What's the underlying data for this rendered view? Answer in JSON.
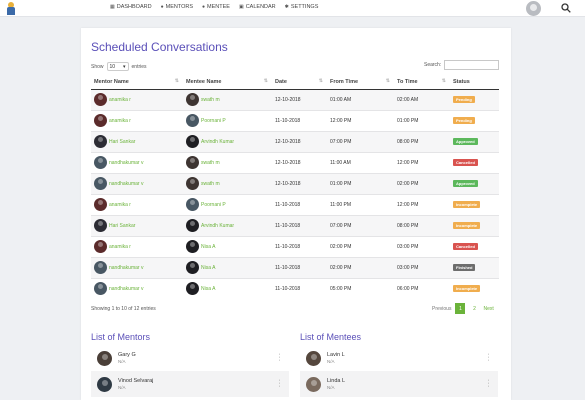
{
  "nav": {
    "items": [
      {
        "label": "DASHBOARD",
        "icon": "grid-icon"
      },
      {
        "label": "MENTORS",
        "icon": "user-icon"
      },
      {
        "label": "MENTEE",
        "icon": "user-icon"
      },
      {
        "label": "CALENDAR",
        "icon": "calendar-icon"
      },
      {
        "label": "SETTINGS",
        "icon": "gear-icon"
      }
    ]
  },
  "conversations": {
    "title": "Scheduled Conversations",
    "show_label": "Show",
    "page_size": "10",
    "entries_label": "entries",
    "search_label": "Search:",
    "search_value": "",
    "columns": [
      "Mentor Name",
      "Mentee Name",
      "Date",
      "From Time",
      "To Time",
      "Status"
    ],
    "rows": [
      {
        "mentor": "anamika r",
        "mentee": "swath m",
        "date": "12-10-2018",
        "from": "01:00 AM",
        "to": "02:00 AM",
        "status": "Pending",
        "color": "#f0ad4e"
      },
      {
        "mentor": "anamika r",
        "mentee": "Poornani P",
        "date": "11-10-2018",
        "from": "12:00 PM",
        "to": "01:00 PM",
        "status": "Pending",
        "color": "#f0ad4e"
      },
      {
        "mentor": "Hari Sankar",
        "mentee": "Arvindh Kumar",
        "date": "12-10-2018",
        "from": "07:00 PM",
        "to": "08:00 PM",
        "status": "Approved",
        "color": "#5cb85c"
      },
      {
        "mentor": "nandhakumar v",
        "mentee": "swath m",
        "date": "12-10-2018",
        "from": "11:00 AM",
        "to": "12:00 PM",
        "status": "Cancelled",
        "color": "#d9534f"
      },
      {
        "mentor": "nandhakumar v",
        "mentee": "swath m",
        "date": "12-10-2018",
        "from": "01:00 PM",
        "to": "02:00 PM",
        "status": "Approved",
        "color": "#5cb85c"
      },
      {
        "mentor": "anamika r",
        "mentee": "Poornani P",
        "date": "11-10-2018",
        "from": "11:00 PM",
        "to": "12:00 PM",
        "status": "Incomplete",
        "color": "#f0ad4e"
      },
      {
        "mentor": "Hari Sankar",
        "mentee": "Arvindh Kumar",
        "date": "11-10-2018",
        "from": "07:00 PM",
        "to": "08:00 PM",
        "status": "Incomplete",
        "color": "#f0ad4e"
      },
      {
        "mentor": "anamika r",
        "mentee": "Nisa A",
        "date": "11-10-2018",
        "from": "02:00 PM",
        "to": "03:00 PM",
        "status": "Cancelled",
        "color": "#d9534f"
      },
      {
        "mentor": "nandhakumar v",
        "mentee": "Nisa A",
        "date": "11-10-2018",
        "from": "02:00 PM",
        "to": "03:00 PM",
        "status": "Finished",
        "color": "#6d6d6d"
      },
      {
        "mentor": "nandhakumar v",
        "mentee": "Nisa A",
        "date": "11-10-2018",
        "from": "05:00 PM",
        "to": "06:00 PM",
        "status": "Incomplete",
        "color": "#f0ad4e"
      }
    ],
    "footer": "Showing 1 to 10 of 12 entries",
    "pagination": {
      "prev": "Previous",
      "pages": [
        "1",
        "2"
      ],
      "next": "Next"
    }
  },
  "mentors": {
    "title": "List of Mentors",
    "items": [
      {
        "name": "Gary G",
        "sub": "N/A"
      },
      {
        "name": "Vinod Selvaraj",
        "sub": "N/A"
      }
    ]
  },
  "mentees": {
    "title": "List of Mentees",
    "items": [
      {
        "name": "Lavin L",
        "sub": "N/A"
      },
      {
        "name": "Linda L",
        "sub": "N/A"
      }
    ]
  }
}
